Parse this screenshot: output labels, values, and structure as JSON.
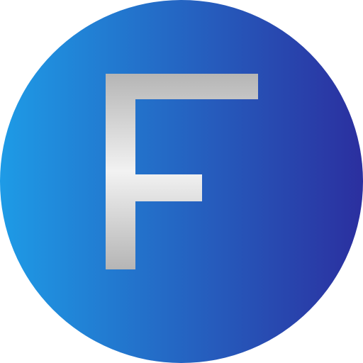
{
  "icon": {
    "name": "letter-f-icon",
    "letter": "F",
    "colors": {
      "circle_gradient_start": "#1e9be6",
      "circle_gradient_end": "#2b2f9f",
      "letter_gradient_light": "#f2f2f2",
      "letter_gradient_mid": "#d2d2d2",
      "letter_gradient_dark": "#b5b5b5"
    }
  }
}
